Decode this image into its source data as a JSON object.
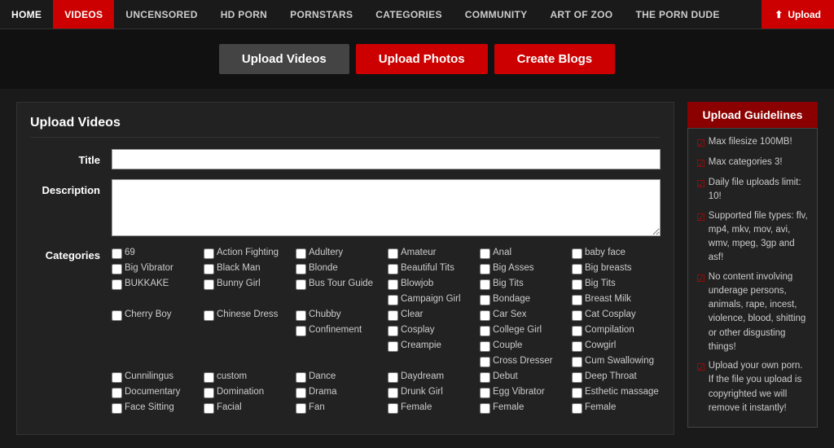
{
  "nav": {
    "items": [
      {
        "label": "HOME",
        "active": false
      },
      {
        "label": "VIDEOS",
        "active": true
      },
      {
        "label": "UNCENSORED",
        "active": false
      },
      {
        "label": "HD PORN",
        "active": false
      },
      {
        "label": "PORNSTARS",
        "active": false
      },
      {
        "label": "CATEGORIES",
        "active": false
      },
      {
        "label": "COMMUNITY",
        "active": false
      },
      {
        "label": "ART OF ZOO",
        "active": false
      },
      {
        "label": "THE PORN DUDE",
        "active": false
      }
    ],
    "upload_btn": "Upload"
  },
  "banner": {
    "tab1": "Upload Videos",
    "tab2": "Upload Photos",
    "tab3": "Create Blogs"
  },
  "form": {
    "title": "Upload Videos",
    "title_label": "Title",
    "description_label": "Description",
    "categories_label": "Categories",
    "title_placeholder": "",
    "description_placeholder": ""
  },
  "categories": [
    "69",
    "Action Fighting",
    "Adultery",
    "Amateur",
    "Anal",
    "baby face",
    "Big Vibrator",
    "Black Man",
    "Blonde",
    "Beautiful Tits",
    "Big Asses",
    "Big breasts",
    "BUKKAKE",
    "Bunny Girl",
    "Bus Tour Guide",
    "Blowjob",
    "Big Tits",
    "Big Tits",
    "",
    "",
    "",
    "Campaign Girl",
    "Bondage",
    "Breast Milk",
    "Cherry Boy",
    "Chinese Dress",
    "Chubby",
    "Clear",
    "Car Sex",
    "Cat Cosplay",
    "",
    "",
    "Confinement",
    "Cosplay",
    "College Girl",
    "Compilation",
    "",
    "",
    "",
    "Creampie",
    "Couple",
    "Cowgirl",
    "",
    "",
    "",
    "",
    "Cross Dresser",
    "Cum Swallowing",
    "Cunnilingus",
    "custom",
    "Dance",
    "Daydream",
    "Debut",
    "Deep Throat",
    "Documentary",
    "Domination",
    "Drama",
    "Drunk Girl",
    "Egg Vibrator",
    "Esthetic massage",
    "Face Sitting",
    "Facial",
    "Fan",
    "Female",
    "Female",
    "Female"
  ],
  "guidelines": {
    "header": "Upload Guidelines",
    "items": [
      {
        "text": "Max filesize 100MB!"
      },
      {
        "text": "Max categories 3!"
      },
      {
        "text": "Daily file uploads limit: 10!"
      },
      {
        "text": "Supported file types: flv, mp4, mkv, mov, avi, wmv, mpeg, 3gp and asf!"
      },
      {
        "text": "No content involving underage persons, animals, rape, incest, violence, blood, shitting or other disgusting things!"
      },
      {
        "text": "Upload your own porn. If the file you upload is copyrighted we will remove it instantly!"
      }
    ]
  }
}
